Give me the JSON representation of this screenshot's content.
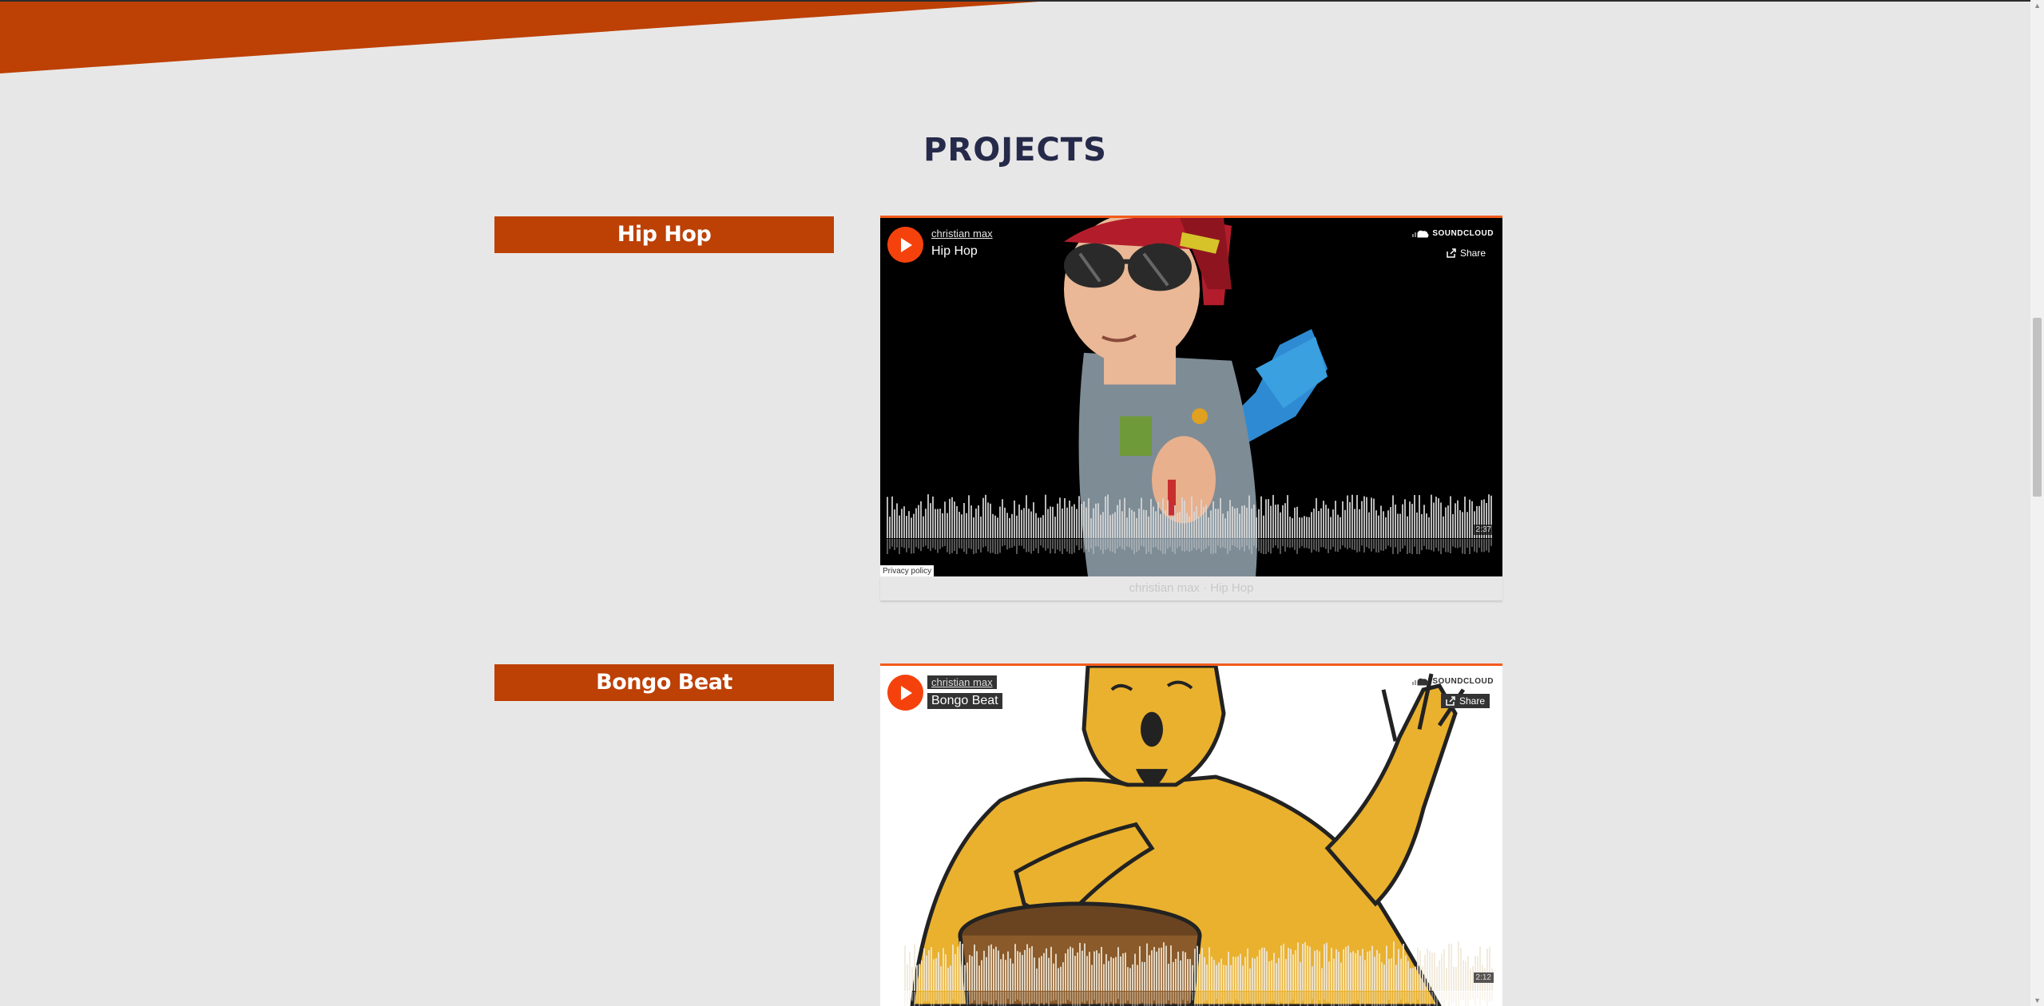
{
  "section": {
    "title": "PROJECTS"
  },
  "colors": {
    "accent": "#bd4004",
    "soundcloud_orange": "#f5420d",
    "title": "#262a4a",
    "background": "#e8e7e7"
  },
  "projects": [
    {
      "tag": "Hip Hop",
      "player": {
        "user": "christian max",
        "track": "Hip Hop",
        "brand": "SOUNDCLOUD",
        "share_label": "Share",
        "duration": "2:37",
        "privacy_label": "Privacy policy",
        "artwork": "cartoon-rapper-artwork"
      },
      "caption": "christian max · Hip Hop"
    },
    {
      "tag": "Bongo Beat",
      "player": {
        "user": "christian max",
        "track": "Bongo Beat",
        "brand": "SOUNDCLOUD",
        "share_label": "Share",
        "duration": "2:12",
        "artwork": "cartoon-bongo-drummer-artwork"
      }
    }
  ]
}
